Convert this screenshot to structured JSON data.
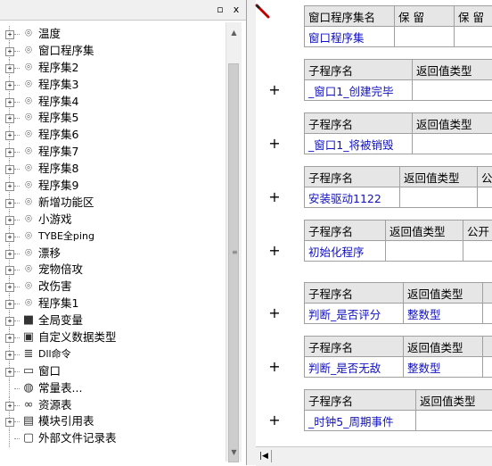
{
  "window_controls": {
    "restore": "▫",
    "close": "x"
  },
  "tree": {
    "items": [
      {
        "expander": "+",
        "icon": "⌾",
        "label": "温度"
      },
      {
        "expander": "+",
        "icon": "⌾",
        "label": "窗口程序集"
      },
      {
        "expander": "+",
        "icon": "⌾",
        "label": "程序集2"
      },
      {
        "expander": "+",
        "icon": "⌾",
        "label": "程序集3"
      },
      {
        "expander": "+",
        "icon": "⌾",
        "label": "程序集4"
      },
      {
        "expander": "+",
        "icon": "⌾",
        "label": "程序集5"
      },
      {
        "expander": "+",
        "icon": "⌾",
        "label": "程序集6"
      },
      {
        "expander": "+",
        "icon": "⌾",
        "label": "程序集7"
      },
      {
        "expander": "+",
        "icon": "⌾",
        "label": "程序集8"
      },
      {
        "expander": "+",
        "icon": "⌾",
        "label": "程序集9"
      },
      {
        "expander": "+",
        "icon": "⌾",
        "label": "新增功能区"
      },
      {
        "expander": "+",
        "icon": "⌾",
        "label": "小游戏"
      },
      {
        "expander": "+",
        "icon": "⌾",
        "label": "TYBE全ping"
      },
      {
        "expander": "+",
        "icon": "⌾",
        "label": "漂移"
      },
      {
        "expander": "+",
        "icon": "⌾",
        "label": "宠物倍攻"
      },
      {
        "expander": "+",
        "icon": "⌾",
        "label": "改伤害"
      },
      {
        "expander": "+",
        "icon": "⌾",
        "label": "程序集1"
      },
      {
        "expander": "+",
        "icon": "■",
        "label": "全局变量"
      },
      {
        "expander": "+",
        "icon": "▣",
        "label": "自定义数据类型"
      },
      {
        "expander": "+",
        "icon": "≣",
        "label": "Dll命令"
      },
      {
        "expander": "+",
        "icon": "▭",
        "label": "窗口"
      },
      {
        "expander": "",
        "icon": "◍",
        "label": "常量表..."
      },
      {
        "expander": "+",
        "icon": "∞",
        "label": "资源表"
      },
      {
        "expander": "+",
        "icon": "▤",
        "label": "模块引用表"
      },
      {
        "expander": "",
        "icon": "▢",
        "label": "外部文件记录表"
      }
    ]
  },
  "editor": {
    "header_table": {
      "columns": [
        "窗口程序集名",
        "保 留",
        "保 留"
      ],
      "values": [
        "窗口程序集",
        "",
        ""
      ]
    },
    "sub_tables": [
      {
        "columns": [
          "子程序名",
          "返回值类型"
        ],
        "values": [
          "_窗口1_创建完毕",
          ""
        ]
      },
      {
        "columns": [
          "子程序名",
          "返回值类型"
        ],
        "values": [
          "_窗口1_将被销毁",
          ""
        ]
      },
      {
        "columns": [
          "子程序名",
          "返回值类型",
          "公"
        ],
        "values": [
          "安装驱动1122",
          "",
          ""
        ]
      },
      {
        "columns": [
          "子程序名",
          "返回值类型",
          "公开"
        ],
        "values": [
          "初始化程序",
          "",
          ""
        ]
      },
      {
        "columns": [
          "子程序名",
          "返回值类型",
          ""
        ],
        "values": [
          "判断_是否评分",
          "整数型",
          ""
        ]
      },
      {
        "columns": [
          "子程序名",
          "返回值类型",
          ""
        ],
        "values": [
          "判断_是否无敌",
          "整数型",
          ""
        ]
      },
      {
        "columns": [
          "子程序名",
          "返回值类型"
        ],
        "values": [
          "_时钟5_周期事件",
          ""
        ]
      }
    ],
    "plus_symbol": "+"
  }
}
